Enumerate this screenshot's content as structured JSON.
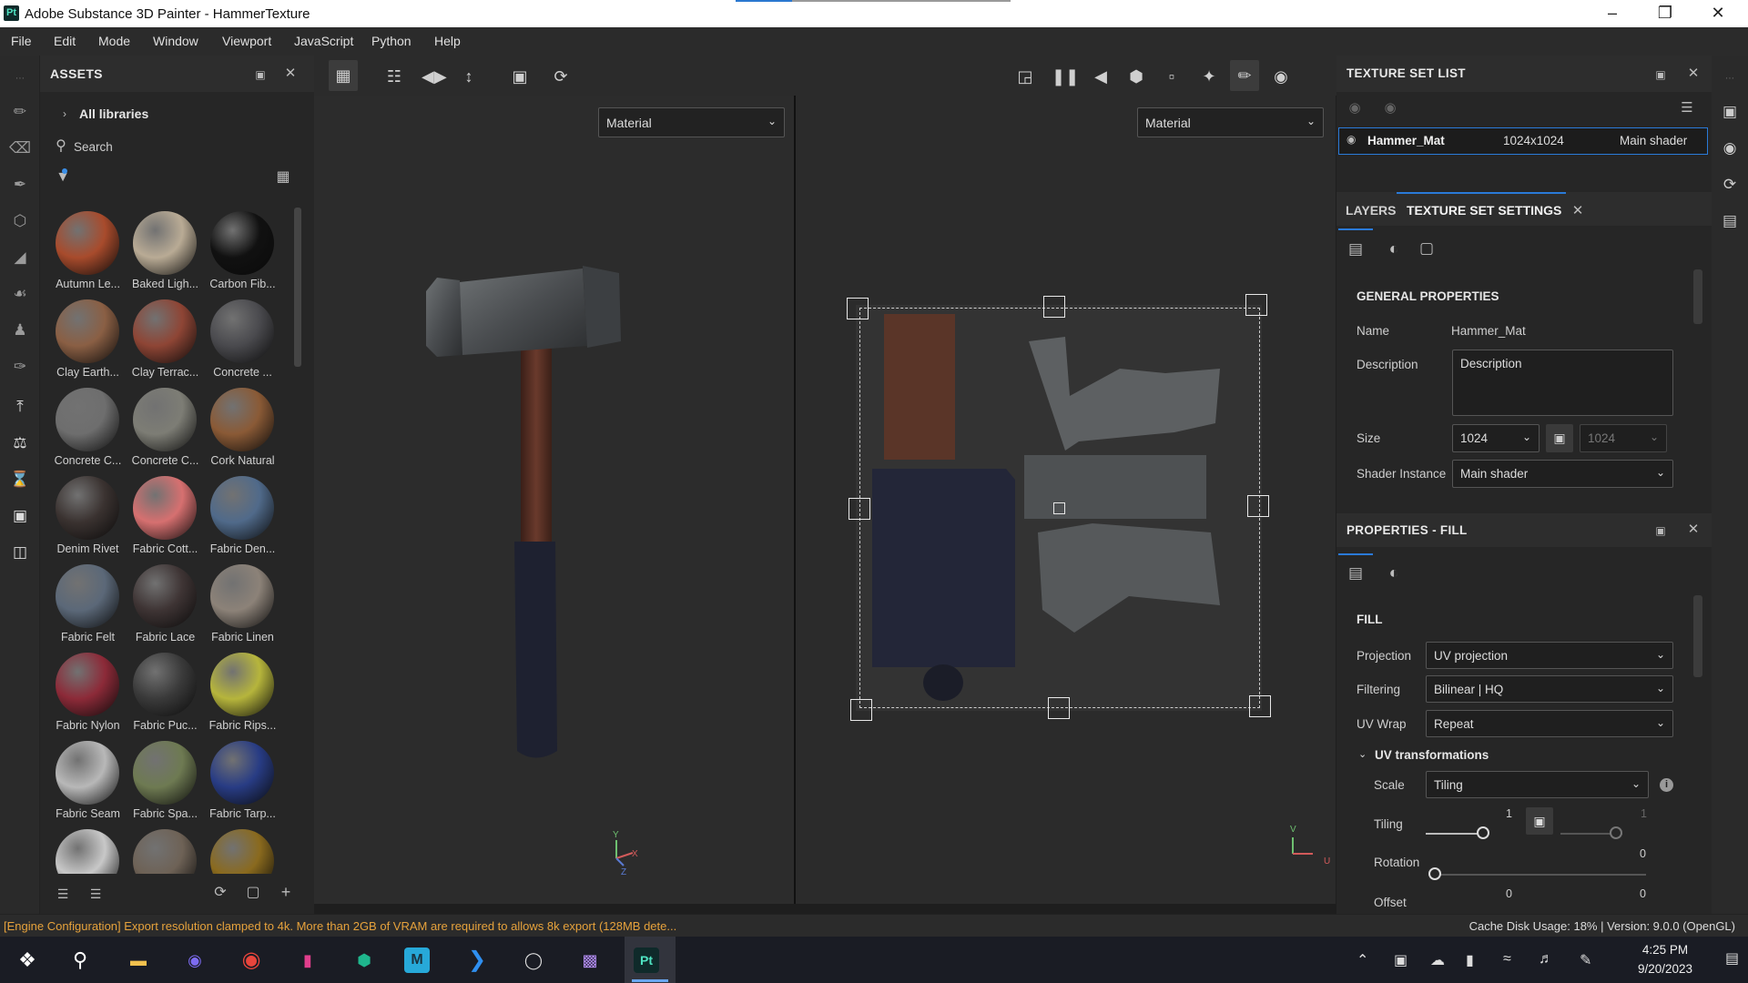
{
  "window": {
    "title": "Adobe Substance 3D Painter - HammerTexture",
    "app_icon": "Pt",
    "controls": [
      "minimize-icon",
      "restore-icon",
      "close-icon"
    ]
  },
  "menu": [
    "File",
    "Edit",
    "Mode",
    "Window",
    "Viewport",
    "JavaScript",
    "Python",
    "Help"
  ],
  "assets": {
    "title": "ASSETS",
    "breadcrumb": "All libraries",
    "search_placeholder": "Search",
    "materials": [
      {
        "name": "Autumn Le...",
        "color": "#a84b2c"
      },
      {
        "name": "Baked Ligh...",
        "color": "#b9ab95"
      },
      {
        "name": "Carbon Fib...",
        "color": "#111111"
      },
      {
        "name": "Clay Earth...",
        "color": "#8a5f44"
      },
      {
        "name": "Clay Terrac...",
        "color": "#8e4535"
      },
      {
        "name": "Concrete ...",
        "color": "#4a4a4e"
      },
      {
        "name": "Concrete C...",
        "color": "#6e6e6e"
      },
      {
        "name": "Concrete C...",
        "color": "#7d7d75"
      },
      {
        "name": "Cork Natural",
        "color": "#8a5a36"
      },
      {
        "name": "Denim Rivet",
        "color": "#3a3230"
      },
      {
        "name": "Fabric Cott...",
        "color": "#d67070"
      },
      {
        "name": "Fabric Den...",
        "color": "#506a8a"
      },
      {
        "name": "Fabric Felt",
        "color": "#5b6878"
      },
      {
        "name": "Fabric Lace",
        "color": "#3e3434"
      },
      {
        "name": "Fabric Linen",
        "color": "#8c8278"
      },
      {
        "name": "Fabric Nylon",
        "color": "#8c2a38"
      },
      {
        "name": "Fabric Puc...",
        "color": "#3a3a3a"
      },
      {
        "name": "Fabric Rips...",
        "color": "#b6b53c"
      },
      {
        "name": "Fabric Seam",
        "color": "#b8b8b8"
      },
      {
        "name": "Fabric Spa...",
        "color": "#6e7a52"
      },
      {
        "name": "Fabric Tarp...",
        "color": "#283c84"
      },
      {
        "name": "",
        "color": "#c8c8c8"
      },
      {
        "name": "",
        "color": "#6e6256"
      },
      {
        "name": "",
        "color": "#8a6a1e"
      }
    ]
  },
  "viewport": {
    "left_mode": "Material",
    "right_mode": "Material",
    "axis_3d": {
      "y": "Y",
      "x": "X",
      "z": "Z"
    },
    "axis_2d": {
      "v": "V",
      "u": "U"
    }
  },
  "texture_set_list": {
    "title": "TEXTURE SET LIST",
    "item": {
      "name": "Hammer_Mat",
      "size": "1024x1024",
      "shader": "Main shader"
    }
  },
  "tabs": {
    "layers": "LAYERS",
    "settings": "TEXTURE SET SETTINGS"
  },
  "general": {
    "title": "GENERAL PROPERTIES",
    "name_label": "Name",
    "name_value": "Hammer_Mat",
    "desc_label": "Description",
    "desc_value": "Description",
    "size_label": "Size",
    "size_value": "1024",
    "size_value2": "1024",
    "shader_label": "Shader Instance",
    "shader_value": "Main shader"
  },
  "fill": {
    "title": "PROPERTIES - FILL",
    "section": "FILL",
    "projection_label": "Projection",
    "projection_value": "UV projection",
    "filtering_label": "Filtering",
    "filtering_value": "Bilinear | HQ",
    "uvwrap_label": "UV Wrap",
    "uvwrap_value": "Repeat",
    "uvtrans": "UV transformations",
    "scale_label": "Scale",
    "scale_value": "Tiling",
    "tiling_label": "Tiling",
    "tiling_value": "1",
    "tiling_value2": "1",
    "rotation_label": "Rotation",
    "rotation_value": "0",
    "offset_label": "Offset",
    "offset_value": "0",
    "offset_value2": "0"
  },
  "status": {
    "message": "[Engine Configuration] Export resolution clamped to 4k. More than 2GB of VRAM are required to allows 8k export (128MB dete...",
    "right": "Cache Disk Usage:  18% | Version: 9.0.0 (OpenGL)"
  },
  "taskbar": {
    "time": "4:25 PM",
    "date": "9/20/2023",
    "apps": [
      "start-icon",
      "search-icon",
      "file-explorer-icon",
      "app-icon",
      "chrome-icon",
      "app-icon",
      "app-icon",
      "maya-icon",
      "vscode-icon",
      "blender-icon",
      "clapper-icon",
      "painter-icon"
    ]
  }
}
